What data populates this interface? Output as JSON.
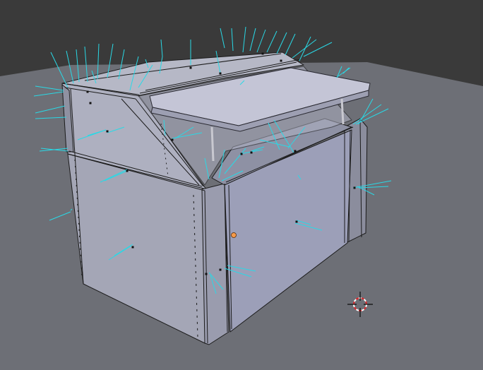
{
  "app": {
    "name": "3D Viewport"
  },
  "viewport": {
    "background_color": "#3a3a3a",
    "ground_color": "#6d6f76",
    "mesh_color": "#a7a9bb",
    "normal_color": "#29d9e6",
    "edge_color": "#1b1b1b",
    "object_origin_color": "#f59a4a",
    "cursor_color": "#e0262a"
  },
  "scene": {
    "objects": [
      {
        "name": "cabinet-mesh",
        "mode": "edit",
        "shows_vertex_normals": true
      },
      {
        "name": "lid-panel",
        "state": "open"
      }
    ],
    "tools": [
      {
        "name": "3d-cursor"
      }
    ]
  }
}
